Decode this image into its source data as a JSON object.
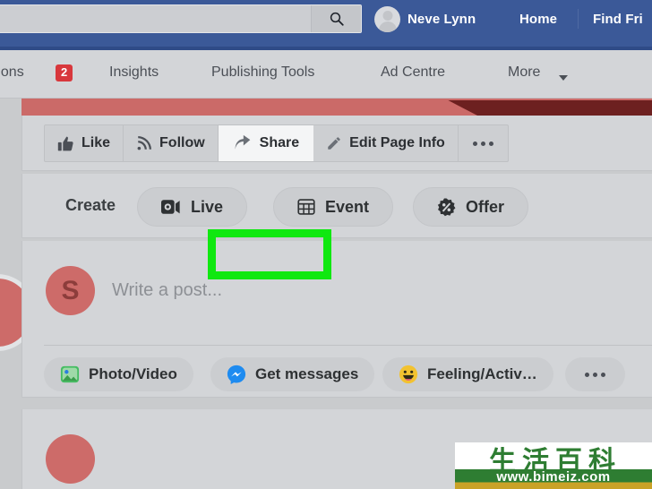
{
  "topbar": {
    "search": {
      "value": "",
      "placeholder": ""
    },
    "search_icon": "search-icon",
    "profile_name": "Neve Lynn",
    "home_label": "Home",
    "find_friends_label": "Find Fri"
  },
  "subnav": {
    "tabs": [
      {
        "label": "cations",
        "badge": "2"
      },
      {
        "label": "Insights"
      },
      {
        "label": "Publishing Tools"
      },
      {
        "label": "Ad Centre"
      },
      {
        "label": "More"
      }
    ]
  },
  "actions": {
    "buttons": [
      {
        "label": "Like",
        "icon": "thumbs-up-icon"
      },
      {
        "label": "Follow",
        "icon": "rss-icon"
      },
      {
        "label": "Share",
        "icon": "share-arrow-icon",
        "highlighted": true
      },
      {
        "label": "Edit Page Info",
        "icon": "pencil-icon"
      },
      {
        "label": "",
        "icon": "more-dots-icon"
      }
    ],
    "highlight_color": "#10e810"
  },
  "create": {
    "label": "Create",
    "items": [
      {
        "label": "Live",
        "icon": "video-camera-icon"
      },
      {
        "label": "Event",
        "icon": "calendar-icon"
      },
      {
        "label": "Offer",
        "icon": "percent-badge-icon"
      }
    ]
  },
  "composer": {
    "avatar_letter": "S",
    "placeholder": "Write a post...",
    "actions": [
      {
        "label": "Photo/Video",
        "icon": "photo-video-icon"
      },
      {
        "label": "Get messages",
        "icon": "messenger-icon"
      },
      {
        "label": "Feeling/Activ…",
        "icon": "smiley-icon"
      },
      {
        "label": "",
        "icon": "more-dots-icon"
      }
    ]
  },
  "watermark": {
    "chinese": "生活百科",
    "url": "www.bimeiz.com"
  }
}
